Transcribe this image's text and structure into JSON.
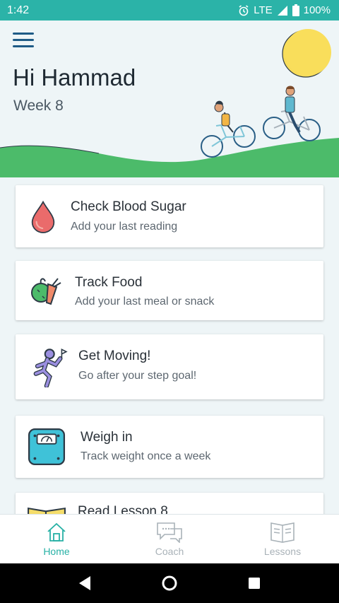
{
  "status_bar": {
    "time": "1:42",
    "network": "LTE",
    "battery": "100%"
  },
  "header": {
    "greeting": "Hi Hammad",
    "week": "Week 8"
  },
  "cards": [
    {
      "title": "Check Blood Sugar",
      "subtitle": "Add your last reading",
      "icon": "blood-drop-icon"
    },
    {
      "title": "Track Food",
      "subtitle": "Add your last meal or snack",
      "icon": "food-icon"
    },
    {
      "title": "Get Moving!",
      "subtitle": "Go after your step goal!",
      "icon": "running-person-icon"
    },
    {
      "title": "Weigh in",
      "subtitle": "Track weight once a week",
      "icon": "scale-icon"
    },
    {
      "title": "Read Lesson 8",
      "subtitle": "",
      "icon": "book-icon"
    }
  ],
  "bottom_nav": [
    {
      "label": "Home",
      "icon": "home-icon",
      "active": true
    },
    {
      "label": "Coach",
      "icon": "chat-icon",
      "active": false
    },
    {
      "label": "Lessons",
      "icon": "lessons-icon",
      "active": false
    }
  ],
  "colors": {
    "accent": "#27b1a5",
    "status_bar": "#2bb3a8",
    "hill": "#4cbb6a",
    "sun": "#f7dc5a"
  }
}
